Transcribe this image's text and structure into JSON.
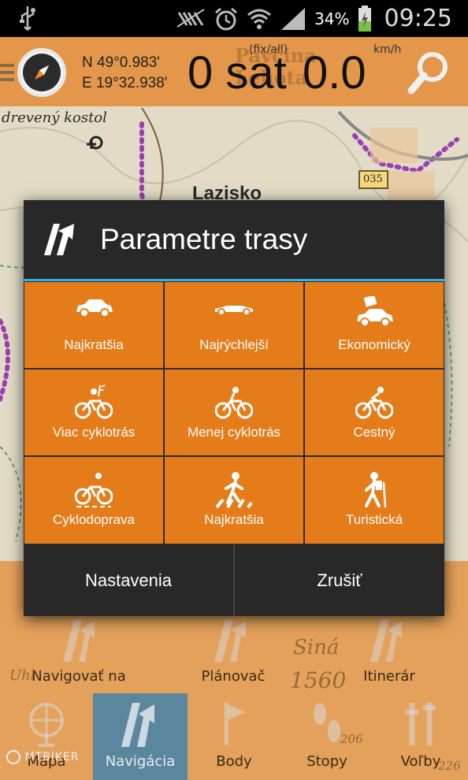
{
  "status_bar": {
    "battery_percent": "34%",
    "time": "09:25"
  },
  "toolbar": {
    "lat": "N 49°0.983'",
    "lon": "E 19°32.938'",
    "sat_label": "(fix/all)",
    "sat_value": "0 sat",
    "speed_unit": "km/h",
    "speed_value": "0.0"
  },
  "map": {
    "labels": {
      "church": "drevený kostol",
      "village": "Lazisko",
      "road_number": "035",
      "peak_name": "Siná",
      "peak_elev": "1560",
      "place": "Uhl",
      "overlay_town": "Pavčina Lehota",
      "road_num_2": "206",
      "road_num_3": "226"
    }
  },
  "dialog": {
    "title": "Parametre trasy",
    "options": [
      {
        "label": "Najkratšia",
        "icon": "car-icon"
      },
      {
        "label": "Najrýchlejší",
        "icon": "race-car-icon"
      },
      {
        "label": "Ekonomický",
        "icon": "eco-car-icon"
      },
      {
        "label": "Viac cyklotrás",
        "icon": "bike-more-icon"
      },
      {
        "label": "Menej cyklotrás",
        "icon": "bike-icon"
      },
      {
        "label": "Cestný",
        "icon": "road-bike-icon"
      },
      {
        "label": "Cyklodoprava",
        "icon": "bike-lane-icon"
      },
      {
        "label": "Najkratšia",
        "icon": "pedestrian-icon"
      },
      {
        "label": "Turistická",
        "icon": "hiker-icon"
      }
    ],
    "buttons": {
      "settings": "Nastavenia",
      "cancel": "Zrušiť"
    }
  },
  "bottom_nav": {
    "row1": [
      "Navigovať na",
      "Plánovač",
      "Itinerár"
    ],
    "row2": [
      "Mapa",
      "Navigácia",
      "Body",
      "Stopy",
      "Voľby"
    ],
    "watermark": "MTBIKER"
  },
  "colors": {
    "accent_orange": "#e57c1a",
    "dialog_bg": "#282828",
    "divider_blue": "#33b5e5"
  }
}
